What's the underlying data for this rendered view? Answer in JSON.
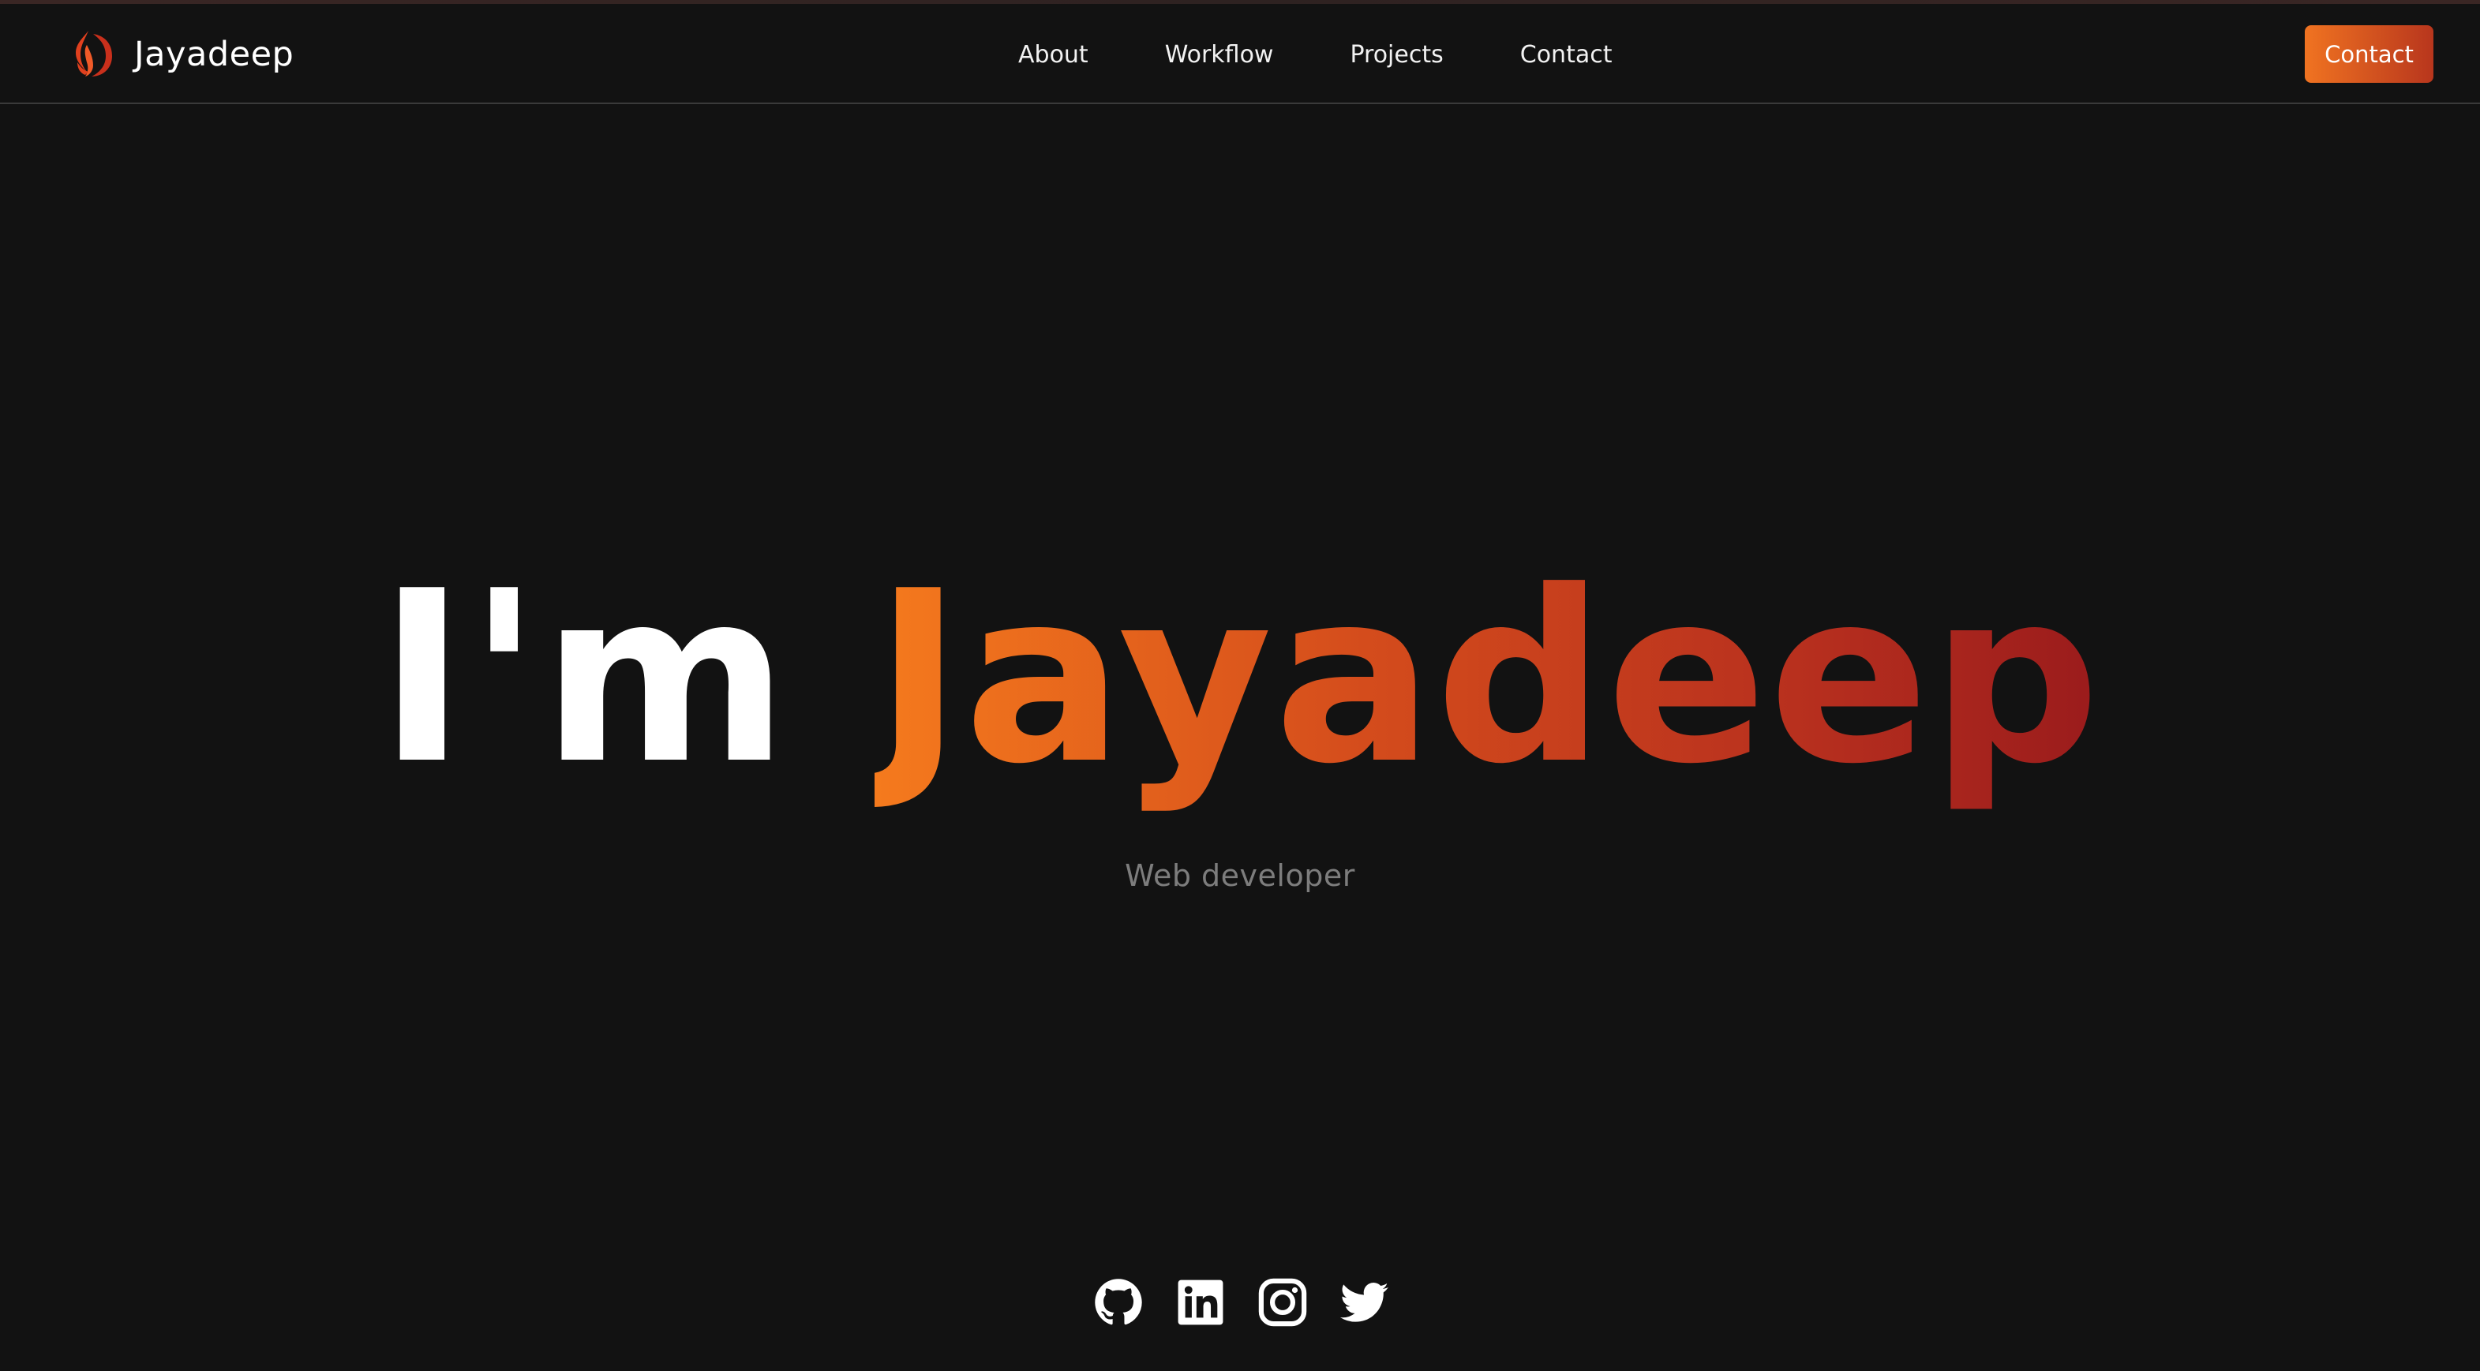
{
  "brand": {
    "name": "Jayadeep",
    "logo_icon": "jd-flame-logo-icon",
    "accent_color": "#e0401e"
  },
  "nav": {
    "items": [
      {
        "label": "About"
      },
      {
        "label": "Workflow"
      },
      {
        "label": "Projects"
      },
      {
        "label": "Contact"
      }
    ]
  },
  "header": {
    "cta_label": "Contact"
  },
  "hero": {
    "prefix": "I'm",
    "name": "Jayadeep",
    "subtitle": "Web developer",
    "gradient_colors": [
      "#f57a1d",
      "#9a1b1c"
    ]
  },
  "socials": [
    {
      "icon": "github-icon"
    },
    {
      "icon": "linkedin-icon"
    },
    {
      "icon": "instagram-icon"
    },
    {
      "icon": "twitter-icon"
    }
  ],
  "colors": {
    "background": "#121212",
    "button_gradient": [
      "#f07321",
      "#b8361d"
    ],
    "subtitle": "#7d7d7d"
  }
}
